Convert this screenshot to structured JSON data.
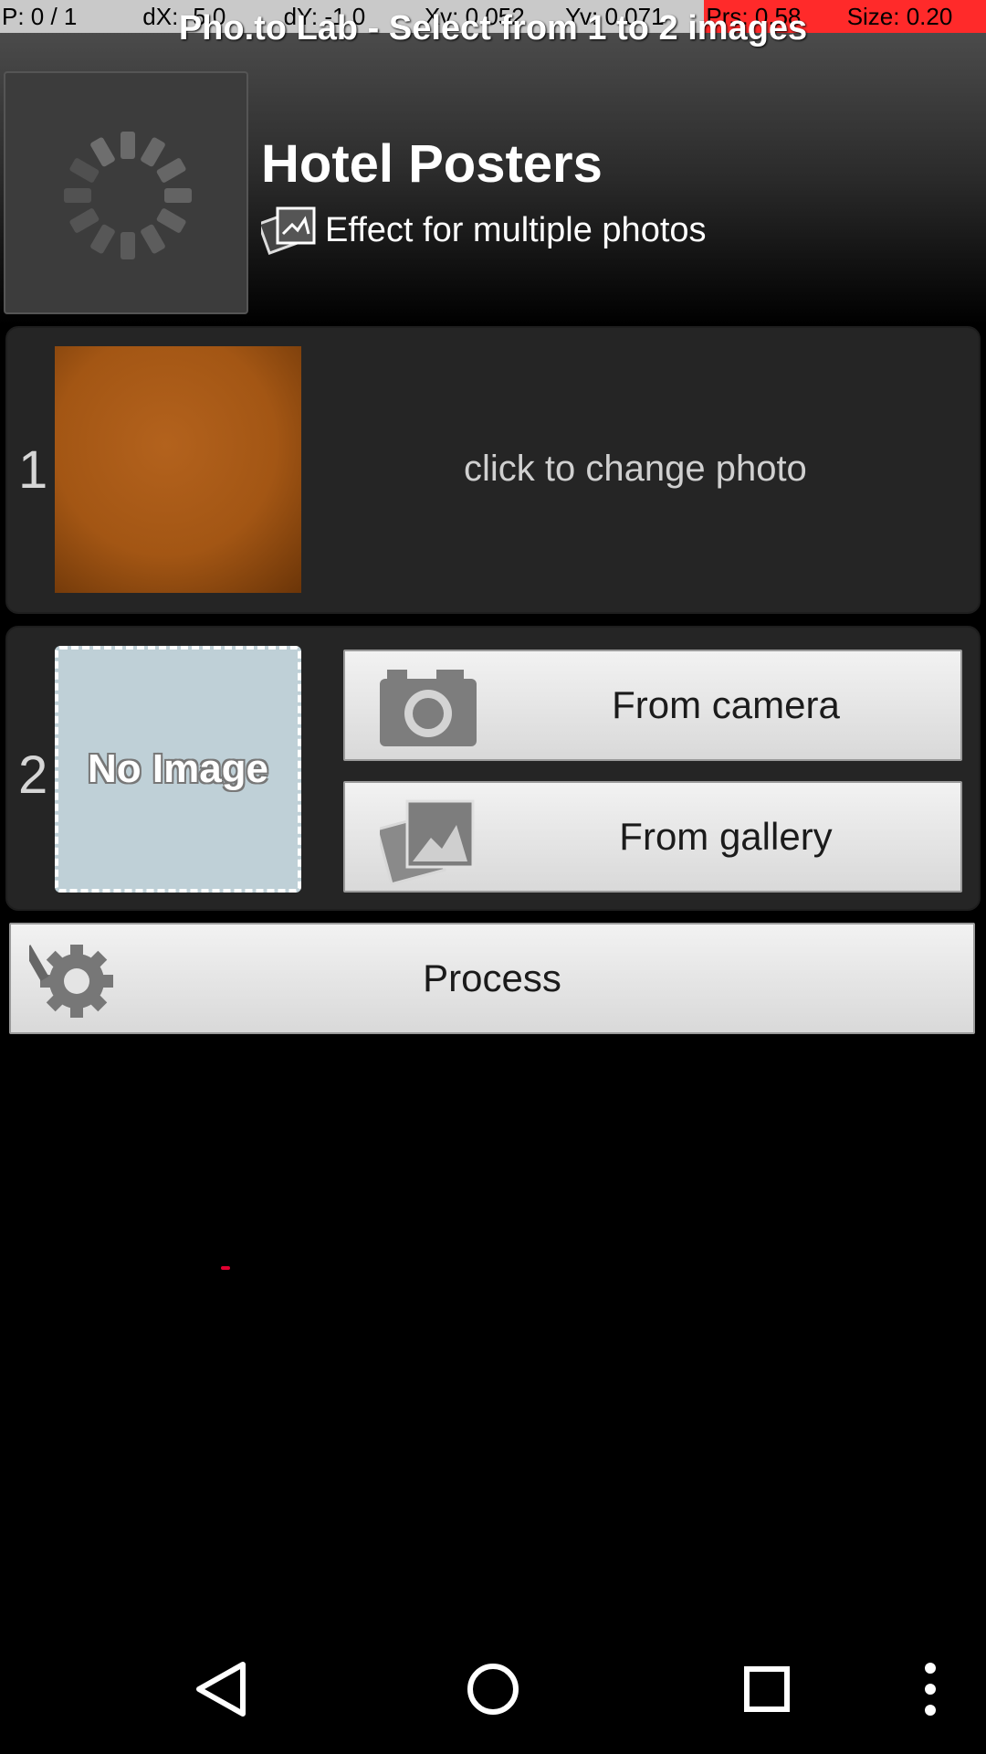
{
  "debug": {
    "p": "P: 0 / 1",
    "dx": "dX: -5.0",
    "dy": "dY: -1.0",
    "xv": "Xv: 0.052",
    "yv": "Yv: 0.071",
    "prs": "Prs: 0.58",
    "size": "Size: 0.20"
  },
  "app_title": "Pho.to Lab - Select from 1 to 2 images",
  "effect": {
    "name": "Hotel Posters",
    "subtitle": "Effect for multiple photos",
    "icon": "multi-photo-icon"
  },
  "slots": [
    {
      "number": "1",
      "hint": "click to change photo"
    },
    {
      "number": "2",
      "placeholder": "No Image"
    }
  ],
  "buttons": {
    "camera": "From camera",
    "gallery": "From gallery",
    "process": "Process"
  },
  "navbar": {
    "back": "back-icon",
    "home": "home-icon",
    "recents": "recents-icon",
    "menu": "overflow-menu-icon"
  }
}
